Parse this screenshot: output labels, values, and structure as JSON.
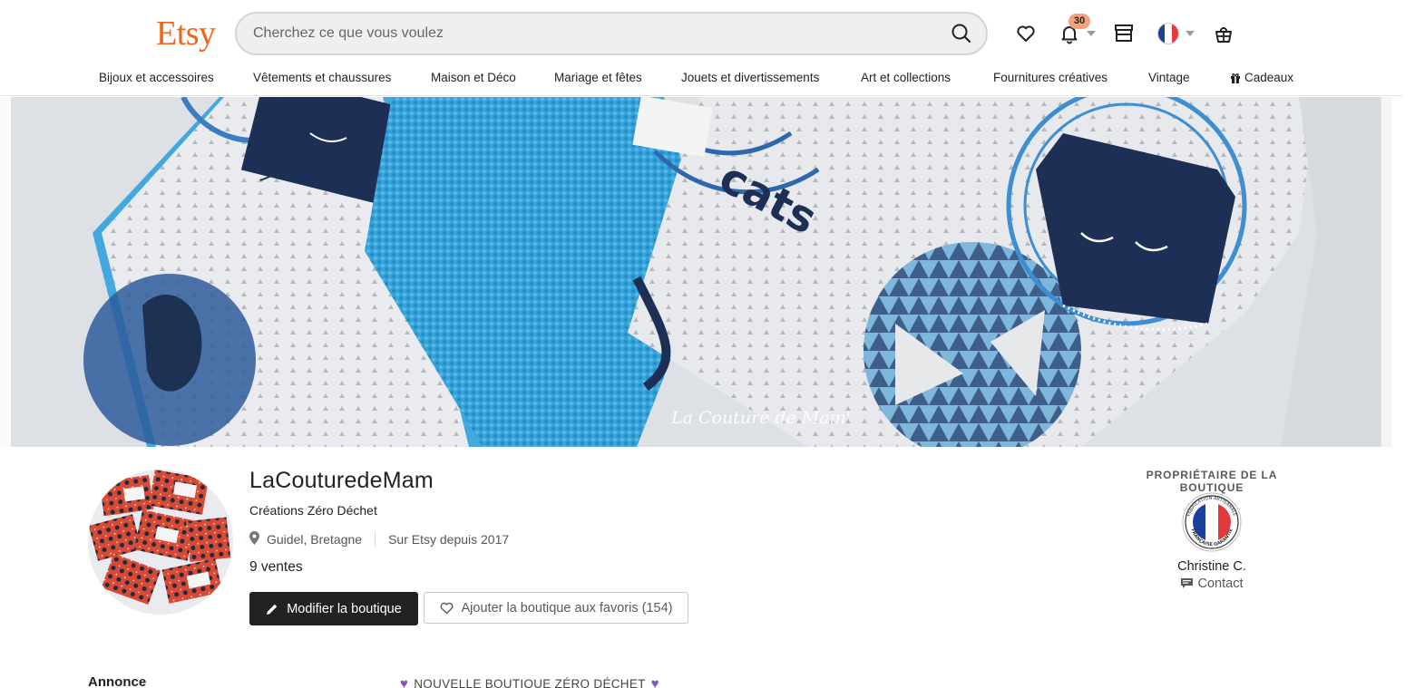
{
  "header": {
    "logo": "Etsy",
    "search_placeholder": "Cherchez ce que vous voulez",
    "notifications_count": "30"
  },
  "categories": [
    "Bijoux et accessoires",
    "Vêtements et chaussures",
    "Maison et Déco",
    "Mariage et fêtes",
    "Jouets et divertissements",
    "Art et collections",
    "Fournitures créatives",
    "Vintage",
    "Cadeaux"
  ],
  "banner": {
    "watermark": "La Couture de Mam'",
    "fabric_text": "cats",
    "colors": {
      "turquoise": "#3aa6db",
      "navy": "#1f2f52",
      "fabric": "#e6e8ea"
    }
  },
  "shop": {
    "name": "LaCouturedeMam",
    "tagline": "Créations Zéro Déchet",
    "location": "Guidel, Bretagne",
    "since": "Sur Etsy depuis 2017",
    "sales": "9 ventes",
    "edit_button": "Modifier la boutique",
    "favorite_button": "Ajouter la boutique aux favoris (154)"
  },
  "owner": {
    "title": "PROPRIÉTAIRE DE LA BOUTIQUE",
    "badge_text_top": "FABRICATION ARTISANALE",
    "badge_text_bottom": "FRANÇAISE GARANTIE",
    "name": "Christine C.",
    "contact": "Contact"
  },
  "announcement": {
    "label": "Annonce",
    "text": "NOUVELLE BOUTIQUE ZÉRO DÉCHET"
  },
  "colors": {
    "brand": "#f1641e",
    "dark_button": "#222222",
    "badge": "#f2a37e"
  }
}
